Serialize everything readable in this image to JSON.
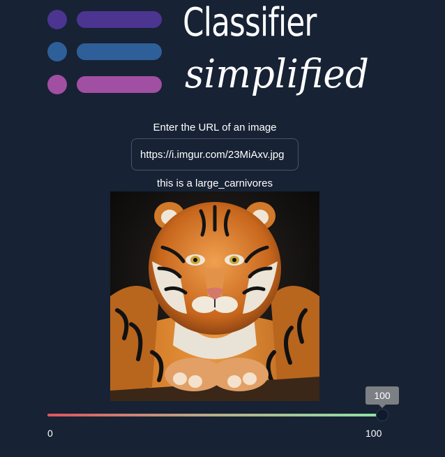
{
  "logo": {
    "title": "Classifier",
    "subtitle": "simplified",
    "colors": {
      "row1": "#4b3591",
      "row2": "#2e5f99",
      "row3": "#a14fa3"
    },
    "icon": "list-logo-icon"
  },
  "url_prompt": {
    "label": "Enter the URL of an image",
    "value": "https://i.imgur.com/23MiAxv.jpg"
  },
  "result": {
    "text": "this is a large_carnivores"
  },
  "image": {
    "subject": "tiger-image"
  },
  "slider": {
    "value": 100,
    "value_label": "100",
    "min": 0,
    "max": 100,
    "min_label": "0",
    "max_label": "100",
    "track_gradient": [
      "#e0555d",
      "#8fe3a3"
    ]
  }
}
